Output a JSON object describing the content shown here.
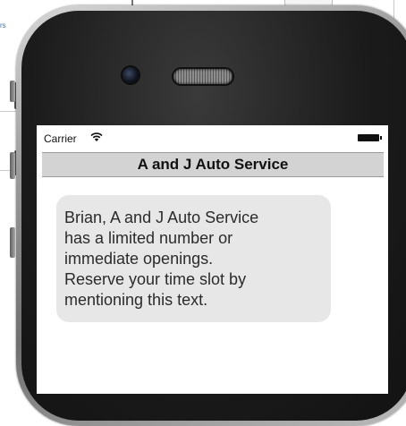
{
  "background_page": {
    "link_fragment": "rs"
  },
  "status_bar": {
    "carrier": "Carrier",
    "wifi_icon": "wifi-icon",
    "battery_icon": "battery-icon"
  },
  "header": {
    "title": "A and J Auto Service"
  },
  "message": {
    "lines": [
      "Brian, A and J Auto Service",
      "has a limited number or",
      "immediate openings.",
      "Reserve your time slot by",
      "mentioning this text."
    ]
  },
  "colors": {
    "title_bar": "#d3d3d3",
    "bubble": "#e7e7e7",
    "phone_bezel": "#1b1b1b"
  }
}
